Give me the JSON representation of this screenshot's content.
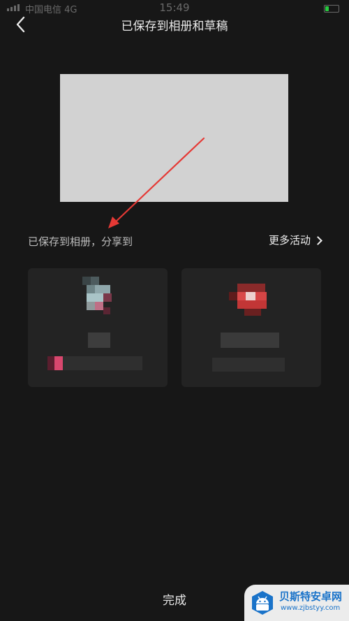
{
  "status_bar": {
    "carrier": "中国电信  4G",
    "time": "15:49",
    "battery_level": 0.3,
    "battery_color": "#27c93f"
  },
  "nav": {
    "title": "已保存到相册和草稿"
  },
  "share": {
    "label": "已保存到相册，分享到",
    "more_label": "更多活动"
  },
  "cards": [
    {
      "icon": "pixelated-app-icon",
      "blurred": true
    },
    {
      "icon": "pixelated-app-icon",
      "blurred": true
    }
  ],
  "done_label": "完成",
  "annotation": {
    "color": "#e53935"
  },
  "watermark": {
    "title": "贝斯特安卓网",
    "url": "www.zjbstyy.com"
  }
}
